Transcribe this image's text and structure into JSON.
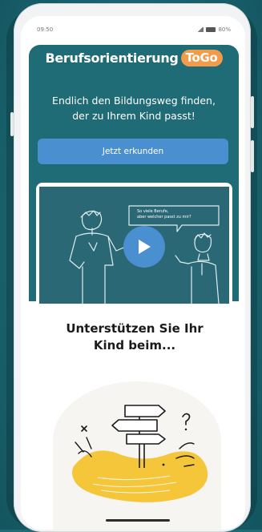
{
  "status_bar": {
    "time": "09:50",
    "indicators": "80%"
  },
  "header": {
    "title": "Berufsorientierung",
    "badge": "ToGo"
  },
  "hero": {
    "subtitle_line1": "Endlich den Bildungsweg finden,",
    "subtitle_line2": "der zu Ihrem Kind passt!",
    "cta_label": "Jetzt erkunden"
  },
  "video": {
    "speech_line1": "So viele Berufe,",
    "speech_line2": "aber welcher passt zu mir?",
    "play_icon": "play-icon"
  },
  "section": {
    "title_line1": "Unterstützen Sie Ihr",
    "title_line2": "Kind beim..."
  },
  "colors": {
    "background": "#1d6b76",
    "hero": "#1f6b76",
    "accent_orange": "#f39b49",
    "button_blue": "#4a8fcf",
    "illustration_yellow": "#f5c53a"
  }
}
